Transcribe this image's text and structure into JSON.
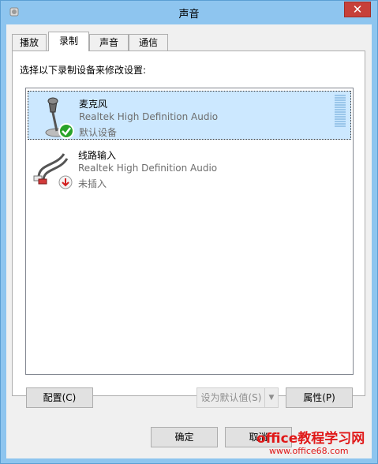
{
  "window": {
    "title": "声音",
    "close_label": "✕"
  },
  "tabs": [
    {
      "label": "播放"
    },
    {
      "label": "录制"
    },
    {
      "label": "声音"
    },
    {
      "label": "通信"
    }
  ],
  "active_tab": "录制",
  "instruction": "选择以下录制设备来修改设置:",
  "devices": [
    {
      "name": "麦克风",
      "driver": "Realtek High Definition Audio",
      "status": "默认设备",
      "icon": "microphone-icon",
      "state": "default-check",
      "selected": true
    },
    {
      "name": "线路输入",
      "driver": "Realtek High Definition Audio",
      "status": "未插入",
      "icon": "line-in-cable-icon",
      "state": "unplugged-arrow",
      "selected": false
    }
  ],
  "buttons": {
    "configure": "配置(C)",
    "set_default": "设为默认值(S)",
    "properties": "属性(P)",
    "ok": "确定",
    "cancel": "取消"
  },
  "watermark": {
    "title": "office教程学习网",
    "url": "www.office68.com"
  },
  "colors": {
    "selection": "#cce8ff",
    "titlebar": "#8ec5ef",
    "close": "#c7403a",
    "watermark": "#e01818"
  }
}
